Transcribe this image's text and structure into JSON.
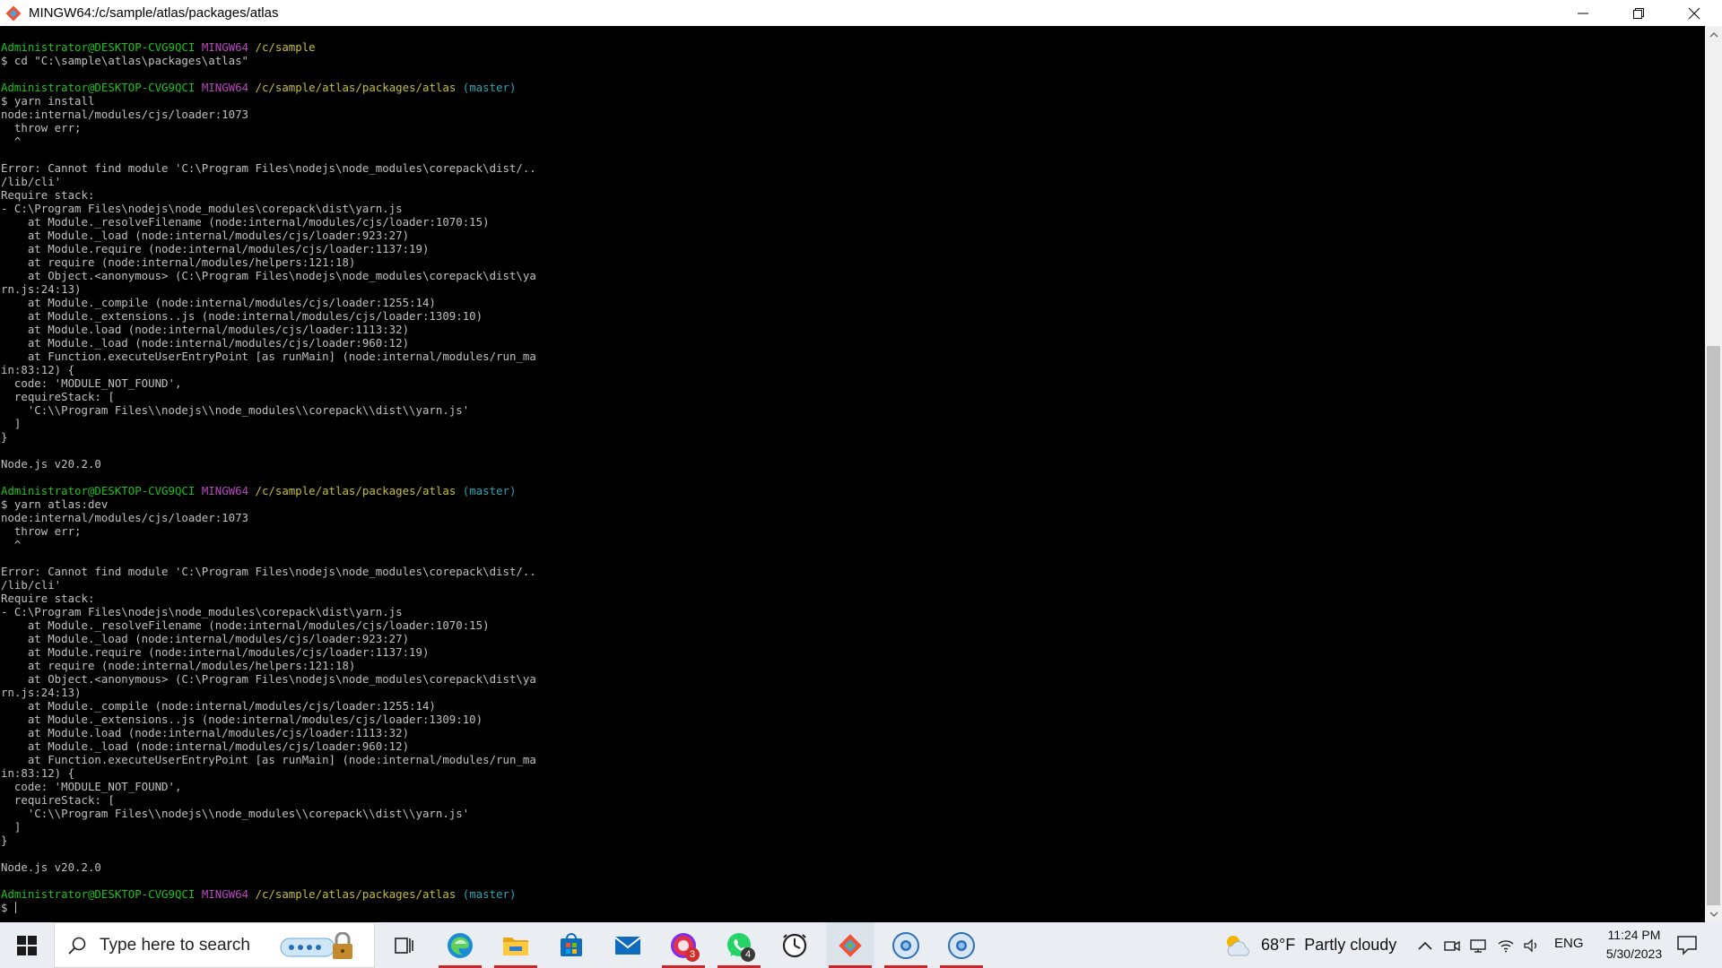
{
  "window": {
    "title": "MINGW64:/c/sample/atlas/packages/atlas"
  },
  "terminal": {
    "lines": [
      {
        "segments": [
          {
            "text": "Administrator@DESKTOP-CVG9QCI",
            "color": "green"
          },
          {
            "text": " "
          },
          {
            "text": "MINGW64",
            "color": "magenta"
          },
          {
            "text": " "
          },
          {
            "text": "/c/sample",
            "color": "yellow"
          }
        ]
      },
      {
        "segments": [
          {
            "text": "$ cd \"C:\\sample\\atlas\\packages\\atlas\""
          }
        ]
      },
      {
        "segments": [
          {
            "text": ""
          }
        ]
      },
      {
        "segments": [
          {
            "text": "Administrator@DESKTOP-CVG9QCI",
            "color": "green"
          },
          {
            "text": " "
          },
          {
            "text": "MINGW64",
            "color": "magenta"
          },
          {
            "text": " "
          },
          {
            "text": "/c/sample/atlas/packages/atlas",
            "color": "yellow"
          },
          {
            "text": " "
          },
          {
            "text": "(master)",
            "color": "cyan"
          }
        ]
      },
      {
        "segments": [
          {
            "text": "$ yarn install"
          }
        ]
      },
      {
        "segments": [
          {
            "text": "node:internal/modules/cjs/loader:1073"
          }
        ]
      },
      {
        "segments": [
          {
            "text": "  throw err;"
          }
        ]
      },
      {
        "segments": [
          {
            "text": "  ^"
          }
        ]
      },
      {
        "segments": [
          {
            "text": ""
          }
        ]
      },
      {
        "segments": [
          {
            "text": "Error: Cannot find module 'C:\\Program Files\\nodejs\\node_modules\\corepack\\dist/.."
          }
        ]
      },
      {
        "segments": [
          {
            "text": "/lib/cli'"
          }
        ]
      },
      {
        "segments": [
          {
            "text": "Require stack:"
          }
        ]
      },
      {
        "segments": [
          {
            "text": "- C:\\Program Files\\nodejs\\node_modules\\corepack\\dist\\yarn.js"
          }
        ]
      },
      {
        "segments": [
          {
            "text": "    at Module._resolveFilename (node:internal/modules/cjs/loader:1070:15)"
          }
        ]
      },
      {
        "segments": [
          {
            "text": "    at Module._load (node:internal/modules/cjs/loader:923:27)"
          }
        ]
      },
      {
        "segments": [
          {
            "text": "    at Module.require (node:internal/modules/cjs/loader:1137:19)"
          }
        ]
      },
      {
        "segments": [
          {
            "text": "    at require (node:internal/modules/helpers:121:18)"
          }
        ]
      },
      {
        "segments": [
          {
            "text": "    at Object.<anonymous> (C:\\Program Files\\nodejs\\node_modules\\corepack\\dist\\ya"
          }
        ]
      },
      {
        "segments": [
          {
            "text": "rn.js:24:13)"
          }
        ]
      },
      {
        "segments": [
          {
            "text": "    at Module._compile (node:internal/modules/cjs/loader:1255:14)"
          }
        ]
      },
      {
        "segments": [
          {
            "text": "    at Module._extensions..js (node:internal/modules/cjs/loader:1309:10)"
          }
        ]
      },
      {
        "segments": [
          {
            "text": "    at Module.load (node:internal/modules/cjs/loader:1113:32)"
          }
        ]
      },
      {
        "segments": [
          {
            "text": "    at Module._load (node:internal/modules/cjs/loader:960:12)"
          }
        ]
      },
      {
        "segments": [
          {
            "text": "    at Function.executeUserEntryPoint [as runMain] (node:internal/modules/run_ma"
          }
        ]
      },
      {
        "segments": [
          {
            "text": "in:83:12) {"
          }
        ]
      },
      {
        "segments": [
          {
            "text": "  code: 'MODULE_NOT_FOUND',"
          }
        ]
      },
      {
        "segments": [
          {
            "text": "  requireStack: ["
          }
        ]
      },
      {
        "segments": [
          {
            "text": "    'C:\\\\Program Files\\\\nodejs\\\\node_modules\\\\corepack\\\\dist\\\\yarn.js'"
          }
        ]
      },
      {
        "segments": [
          {
            "text": "  ]"
          }
        ]
      },
      {
        "segments": [
          {
            "text": "}"
          }
        ]
      },
      {
        "segments": [
          {
            "text": ""
          }
        ]
      },
      {
        "segments": [
          {
            "text": "Node.js v20.2.0"
          }
        ]
      },
      {
        "segments": [
          {
            "text": ""
          }
        ]
      },
      {
        "segments": [
          {
            "text": "Administrator@DESKTOP-CVG9QCI",
            "color": "green"
          },
          {
            "text": " "
          },
          {
            "text": "MINGW64",
            "color": "magenta"
          },
          {
            "text": " "
          },
          {
            "text": "/c/sample/atlas/packages/atlas",
            "color": "yellow"
          },
          {
            "text": " "
          },
          {
            "text": "(master)",
            "color": "cyan"
          }
        ]
      },
      {
        "segments": [
          {
            "text": "$ yarn atlas:dev"
          }
        ]
      },
      {
        "segments": [
          {
            "text": "node:internal/modules/cjs/loader:1073"
          }
        ]
      },
      {
        "segments": [
          {
            "text": "  throw err;"
          }
        ]
      },
      {
        "segments": [
          {
            "text": "  ^"
          }
        ]
      },
      {
        "segments": [
          {
            "text": ""
          }
        ]
      },
      {
        "segments": [
          {
            "text": "Error: Cannot find module 'C:\\Program Files\\nodejs\\node_modules\\corepack\\dist/.."
          }
        ]
      },
      {
        "segments": [
          {
            "text": "/lib/cli'"
          }
        ]
      },
      {
        "segments": [
          {
            "text": "Require stack:"
          }
        ]
      },
      {
        "segments": [
          {
            "text": "- C:\\Program Files\\nodejs\\node_modules\\corepack\\dist\\yarn.js"
          }
        ]
      },
      {
        "segments": [
          {
            "text": "    at Module._resolveFilename (node:internal/modules/cjs/loader:1070:15)"
          }
        ]
      },
      {
        "segments": [
          {
            "text": "    at Module._load (node:internal/modules/cjs/loader:923:27)"
          }
        ]
      },
      {
        "segments": [
          {
            "text": "    at Module.require (node:internal/modules/cjs/loader:1137:19)"
          }
        ]
      },
      {
        "segments": [
          {
            "text": "    at require (node:internal/modules/helpers:121:18)"
          }
        ]
      },
      {
        "segments": [
          {
            "text": "    at Object.<anonymous> (C:\\Program Files\\nodejs\\node_modules\\corepack\\dist\\ya"
          }
        ]
      },
      {
        "segments": [
          {
            "text": "rn.js:24:13)"
          }
        ]
      },
      {
        "segments": [
          {
            "text": "    at Module._compile (node:internal/modules/cjs/loader:1255:14)"
          }
        ]
      },
      {
        "segments": [
          {
            "text": "    at Module._extensions..js (node:internal/modules/cjs/loader:1309:10)"
          }
        ]
      },
      {
        "segments": [
          {
            "text": "    at Module.load (node:internal/modules/cjs/loader:1113:32)"
          }
        ]
      },
      {
        "segments": [
          {
            "text": "    at Module._load (node:internal/modules/cjs/loader:960:12)"
          }
        ]
      },
      {
        "segments": [
          {
            "text": "    at Function.executeUserEntryPoint [as runMain] (node:internal/modules/run_ma"
          }
        ]
      },
      {
        "segments": [
          {
            "text": "in:83:12) {"
          }
        ]
      },
      {
        "segments": [
          {
            "text": "  code: 'MODULE_NOT_FOUND',"
          }
        ]
      },
      {
        "segments": [
          {
            "text": "  requireStack: ["
          }
        ]
      },
      {
        "segments": [
          {
            "text": "    'C:\\\\Program Files\\\\nodejs\\\\node_modules\\\\corepack\\\\dist\\\\yarn.js'"
          }
        ]
      },
      {
        "segments": [
          {
            "text": "  ]"
          }
        ]
      },
      {
        "segments": [
          {
            "text": "}"
          }
        ]
      },
      {
        "segments": [
          {
            "text": ""
          }
        ]
      },
      {
        "segments": [
          {
            "text": "Node.js v20.2.0"
          }
        ]
      },
      {
        "segments": [
          {
            "text": ""
          }
        ]
      },
      {
        "segments": [
          {
            "text": "Administrator@DESKTOP-CVG9QCI",
            "color": "green"
          },
          {
            "text": " "
          },
          {
            "text": "MINGW64",
            "color": "magenta"
          },
          {
            "text": " "
          },
          {
            "text": "/c/sample/atlas/packages/atlas",
            "color": "yellow"
          },
          {
            "text": " "
          },
          {
            "text": "(master)",
            "color": "cyan"
          }
        ]
      },
      {
        "segments": [
          {
            "text": "$ "
          }
        ],
        "cursor": true
      }
    ]
  },
  "colors": {
    "green": "#1cc21c",
    "magenta": "#b948c0",
    "yellow": "#c5bd3d",
    "cyan": "#2aa5b5",
    "terminal_bg": "#000000",
    "taskbar_bg": "#eaeef3",
    "active_underline": "#c9262a"
  },
  "taskbar": {
    "search_placeholder": "Type here to search",
    "apps": [
      {
        "name": "task-view-icon"
      },
      {
        "name": "edge-icon"
      },
      {
        "name": "file-explorer-icon"
      },
      {
        "name": "microsoft-store-icon"
      },
      {
        "name": "mail-icon"
      },
      {
        "name": "chat-app-icon",
        "badge": "3"
      },
      {
        "name": "whatsapp-icon",
        "badge": "4"
      },
      {
        "name": "clock-app-icon"
      },
      {
        "name": "git-bash-icon"
      },
      {
        "name": "chrome-profile-1-icon"
      },
      {
        "name": "chrome-profile-2-icon"
      }
    ],
    "weather": {
      "temperature": "68°F",
      "condition": "Partly cloudy"
    },
    "language": "ENG",
    "time": "11:24 PM",
    "date": "5/30/2023"
  }
}
